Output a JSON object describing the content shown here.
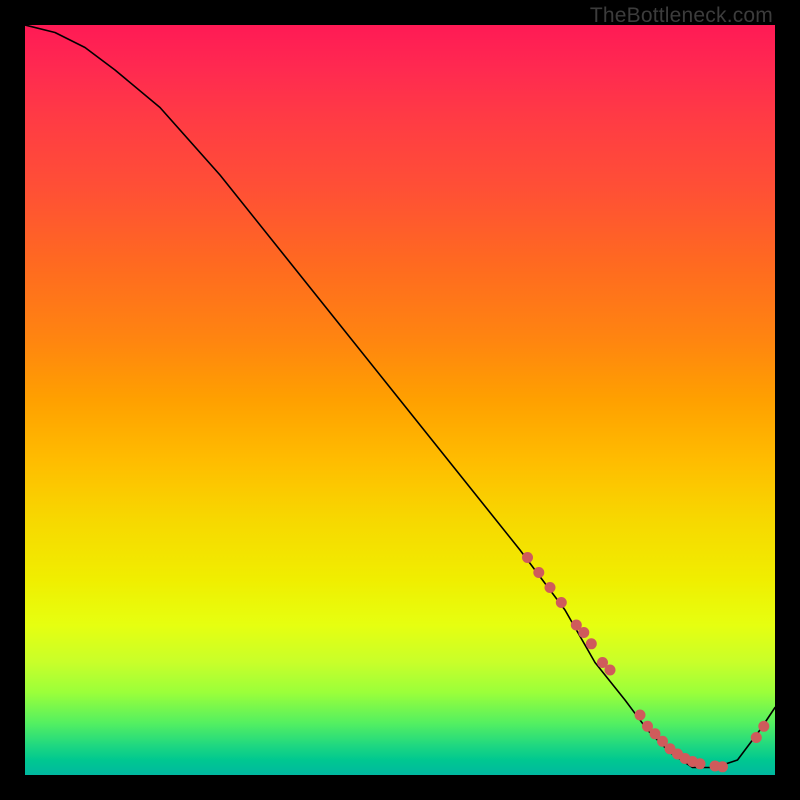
{
  "watermark": "TheBottleneck.com",
  "chart_data": {
    "type": "line",
    "title": "",
    "xlabel": "",
    "ylabel": "",
    "xlim": [
      0,
      100
    ],
    "ylim": [
      0,
      100
    ],
    "grid": false,
    "legend": "none",
    "series": [
      {
        "name": "bottleneck-curve",
        "x": [
          0,
          4,
          8,
          12,
          18,
          26,
          34,
          42,
          50,
          58,
          66,
          72,
          76,
          80,
          83,
          86,
          89,
          92,
          95,
          98,
          100
        ],
        "values": [
          100,
          99,
          97,
          94,
          89,
          80,
          70,
          60,
          50,
          40,
          30,
          22,
          15,
          10,
          6,
          3,
          1,
          1,
          2,
          6,
          9
        ]
      }
    ],
    "highlighted_points": {
      "name": "segment-markers",
      "x": [
        67,
        68.5,
        70,
        71.5,
        73.5,
        74.5,
        75.5,
        77,
        78,
        82,
        83,
        84,
        85,
        86,
        87,
        88,
        89,
        90,
        92,
        93,
        97.5,
        98.5
      ],
      "values": [
        29,
        27,
        25,
        23,
        20,
        19,
        17.5,
        15,
        14,
        8,
        6.5,
        5.5,
        4.5,
        3.5,
        2.8,
        2.2,
        1.8,
        1.5,
        1.2,
        1.1,
        5,
        6.5
      ]
    }
  }
}
